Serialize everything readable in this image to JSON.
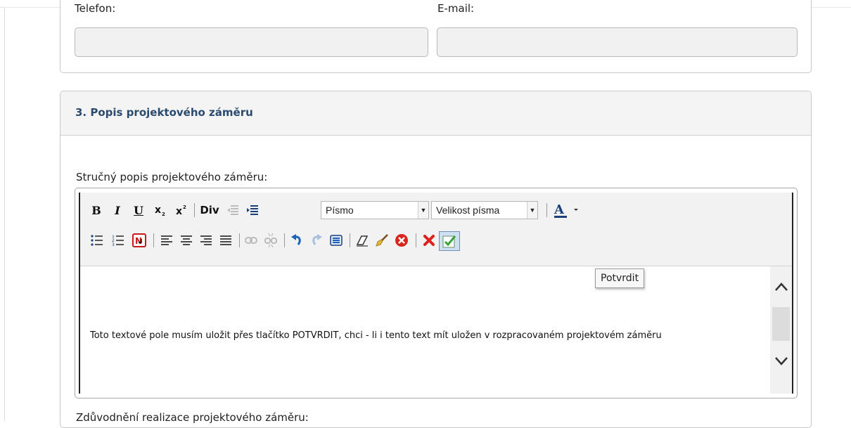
{
  "contact": {
    "phone_label": "Telefon:",
    "email_label": "E-mail:"
  },
  "section3": {
    "title": "3. Popis projektového záměru",
    "short_desc_label": "Stručný popis projektového záměru:",
    "justification_label": "Zdůvodnění realizace projektového záměru:"
  },
  "editor": {
    "toolbar": {
      "bold": "B",
      "italic": "I",
      "underline": "U",
      "div": "Div",
      "font_select": "Písmo",
      "size_select": "Velikost písma"
    },
    "tooltip": "Potvrdit",
    "content": "Toto textové pole musím uložit přes tlačítko POTVRDIT, chci - li i tento text mít uložen v rozpracovaném projektovém záměru"
  },
  "colors": {
    "section_title": "#2a4a6e",
    "cancel_red": "#e0201c",
    "confirm_green": "#3aa33a"
  },
  "icons": {
    "row1": [
      "bold-icon",
      "italic-icon",
      "underline-icon",
      "subscript-icon",
      "superscript-icon",
      "div-icon",
      "outdent-icon",
      "indent-icon",
      "font-color-icon"
    ],
    "row2": [
      "bulleted-list-icon",
      "numbered-list-icon",
      "paste-word-icon",
      "align-left-icon",
      "align-center-icon",
      "align-right-icon",
      "justify-icon",
      "link-icon",
      "unlink-icon",
      "undo-icon",
      "redo-icon",
      "select-all-icon",
      "remove-format-icon",
      "cleanup-icon",
      "clear-icon",
      "cancel-icon",
      "confirm-icon"
    ]
  }
}
